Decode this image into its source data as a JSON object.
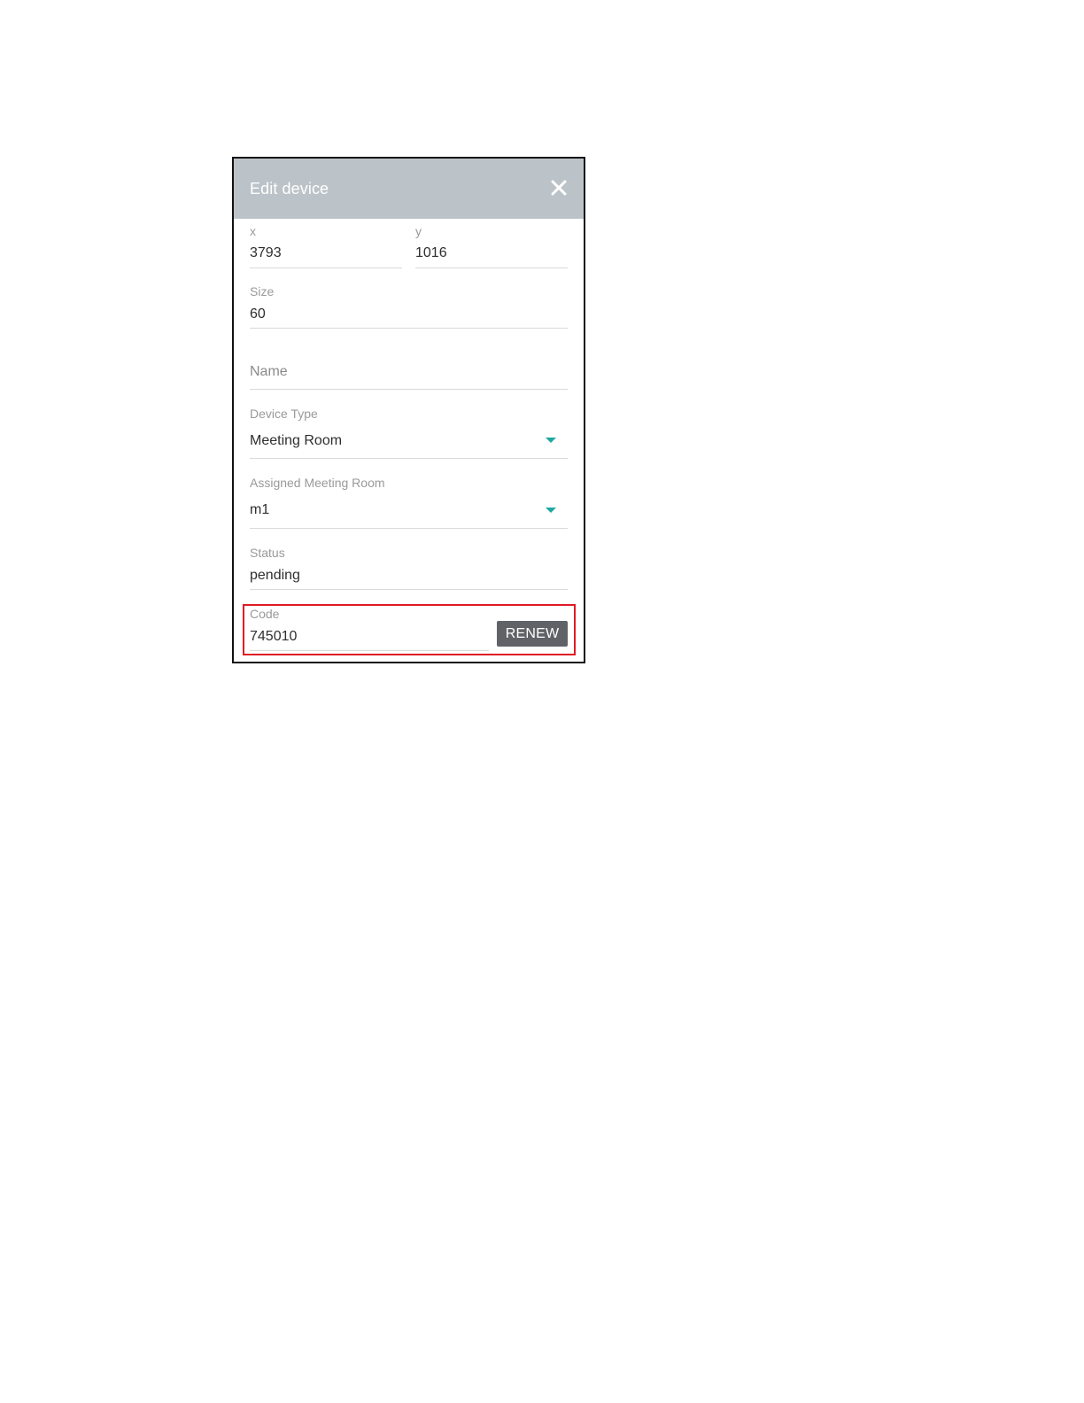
{
  "dialog": {
    "title": "Edit device",
    "close_icon": "close-icon",
    "fields": {
      "x": {
        "label": "x",
        "value": "3793"
      },
      "y": {
        "label": "y",
        "value": "1016"
      },
      "size": {
        "label": "Size",
        "value": "60"
      },
      "name": {
        "placeholder": "Name",
        "value": ""
      },
      "device_type": {
        "label": "Device Type",
        "value": "Meeting Room",
        "icon": "chevron-down-icon"
      },
      "assigned_meeting_room": {
        "label": "Assigned Meeting Room",
        "value": "m1",
        "icon": "chevron-down-icon"
      },
      "status": {
        "label": "Status",
        "value": "pending"
      },
      "code": {
        "label": "Code",
        "value": "745010"
      }
    },
    "renew_label": "RENEW"
  },
  "colors": {
    "header_bg": "#bcc3c8",
    "accent": "#1fa8a2",
    "button_bg": "#5f6367",
    "highlight": "#e01b24"
  }
}
